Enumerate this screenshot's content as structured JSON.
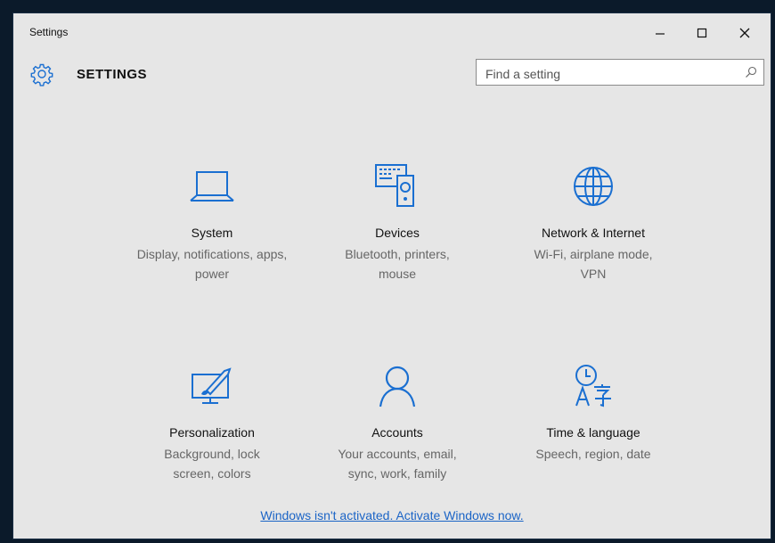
{
  "window": {
    "title": "Settings",
    "controls": {
      "minimize": "minimize-icon",
      "maximize": "maximize-icon",
      "close": "close-icon"
    }
  },
  "header": {
    "heading": "SETTINGS",
    "search": {
      "placeholder": "Find a setting",
      "value": ""
    }
  },
  "tiles": [
    {
      "title": "System",
      "desc": "Display, notifications, apps, power",
      "icon": "laptop-icon"
    },
    {
      "title": "Devices",
      "desc": "Bluetooth, printers, mouse",
      "icon": "devices-icon"
    },
    {
      "title": "Network & Internet",
      "desc": "Wi-Fi, airplane mode, VPN",
      "icon": "globe-icon"
    },
    {
      "title": "Personalization",
      "desc": "Background, lock screen, colors",
      "icon": "personalization-icon"
    },
    {
      "title": "Accounts",
      "desc": "Your accounts, email, sync, work, family",
      "icon": "person-icon"
    },
    {
      "title": "Time & language",
      "desc": "Speech, region, date",
      "icon": "time-language-icon"
    }
  ],
  "activation": {
    "link_text": "Windows isn't activated. Activate Windows now."
  },
  "colors": {
    "accent": "#1b64c6",
    "background": "#e6e6e6",
    "icon": "#1a6fd1"
  }
}
